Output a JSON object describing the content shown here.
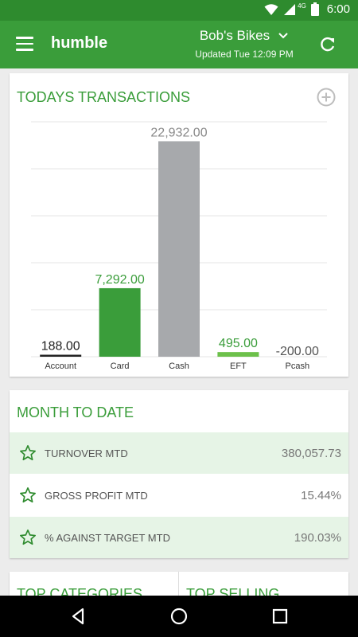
{
  "status_bar": {
    "time": "6:00",
    "network": "4G",
    "icons": [
      "wifi-icon",
      "signal-icon",
      "battery-icon"
    ]
  },
  "app_bar": {
    "brand": "humble",
    "store_name": "Bob's Bikes",
    "updated": "Updated Tue 12:09 PM"
  },
  "transactions": {
    "title": "TODAYS TRANSACTIONS"
  },
  "chart_data": {
    "type": "bar",
    "categories": [
      "Account",
      "Card",
      "Cash",
      "EFT",
      "Pcash"
    ],
    "values": [
      188.0,
      7292.0,
      22932.0,
      495.0,
      -200.0
    ],
    "value_labels": [
      "188.00",
      "7,292.00",
      "22,932.00",
      "495.00",
      "-200.00"
    ],
    "colors": [
      "#222222",
      "#3a9d3a",
      "#a7a9ac",
      "#6cc04a",
      "#999999"
    ],
    "label_colors": [
      "#222222",
      "#3a9d3a",
      "#888888",
      "#3a9d3a",
      "#555555"
    ],
    "ylim": [
      0,
      25000
    ],
    "grid": true,
    "title": "",
    "xlabel": "",
    "ylabel": ""
  },
  "month_to_date": {
    "title": "MONTH TO DATE",
    "rows": [
      {
        "label": "TURNOVER MTD",
        "value": "380,057.73"
      },
      {
        "label": "GROSS PROFIT MTD",
        "value": "15.44%"
      },
      {
        "label": "% AGAINST TARGET MTD",
        "value": "190.03%"
      }
    ]
  },
  "bottom": {
    "left_title": "TOP CATEGORIES",
    "right_title": "TOP SELLING"
  },
  "nav_bar": {
    "buttons": [
      "back-icon",
      "home-icon",
      "recents-icon"
    ]
  }
}
